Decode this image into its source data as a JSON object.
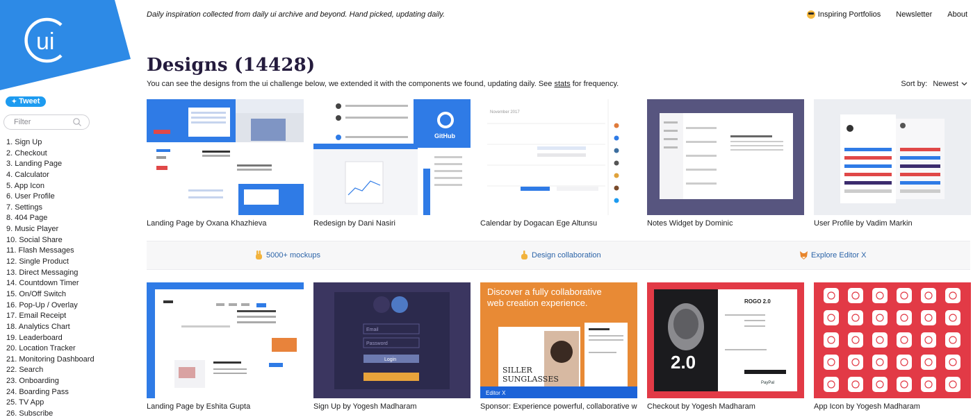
{
  "sidebar": {
    "logo_text": "ui",
    "tweet_label": "Tweet",
    "filter_placeholder": "Filter",
    "categories": [
      "1. Sign Up",
      "2. Checkout",
      "3. Landing Page",
      "4. Calculator",
      "5. App Icon",
      "6. User Profile",
      "7. Settings",
      "8. 404 Page",
      "9. Music Player",
      "10. Social Share",
      "11. Flash Messages",
      "12. Single Product",
      "13. Direct Messaging",
      "14. Countdown Timer",
      "15. On/Off Switch",
      "16. Pop-Up / Overlay",
      "17. Email Receipt",
      "18. Analytics Chart",
      "19. Leaderboard",
      "20. Location Tracker",
      "21. Monitoring Dashboard",
      "22. Search",
      "23. Onboarding",
      "24. Boarding Pass",
      "25. TV App",
      "26. Subscribe"
    ]
  },
  "header": {
    "tagline": "Daily inspiration collected from daily ui archive and beyond. Hand picked, updating daily.",
    "nav": [
      "Inspiring Portfolios",
      "Newsletter",
      "About"
    ]
  },
  "main": {
    "title": "Designs (14428)",
    "subtitle_before": "You can see the designs from the ui challenge below, we extended it with the components we found, updating daily. See ",
    "subtitle_link": "stats",
    "subtitle_after": " for frequency.",
    "sort_label": "Sort by:",
    "sort_value": "Newest"
  },
  "row1": [
    "Landing Page by Oxana Khazhieva",
    "Redesign by Dani Nasiri",
    "Calendar by Dogacan Ege Altunsu",
    "Notes Widget by Dominic",
    "User Profile by Vadim Markin"
  ],
  "promo": [
    "5000+ mockups",
    "Design collaboration",
    "Explore Editor X"
  ],
  "row2": [
    "Landing Page by Eshita Gupta",
    "Sign Up by Yogesh Madharam",
    "Sponsor: Experience powerful, collaborative web",
    "Checkout by Yogesh Madharam",
    "App Icon by Yogesh Madharam"
  ],
  "thumb_text": {
    "github": "GitHub",
    "calendar_month": "November 2017",
    "signup_email": "Email",
    "signup_password": "Password",
    "signup_button": "Login",
    "sponsor_headline_1": "Discover a fully collaborative",
    "sponsor_headline_2": "web creation experience.",
    "sponsor_card_1": "SILLER",
    "sponsor_card_2": "SUNGLASSES",
    "sponsor_footer": "Editor X",
    "checkout_brand": "ROGO 2.0",
    "checkout_number": "2.0",
    "checkout_paypal": "PayPal"
  },
  "colors": {
    "brand_blue": "#2d8ae6",
    "title_purple": "#241b3d",
    "link_blue": "#2c64a8",
    "tweet_blue": "#1d9bf0"
  },
  "icons": {
    "portfolios": "sunglasses-emoji-icon",
    "sort": "chevron-down-icon",
    "filter": "search-icon",
    "promo": [
      "victory-hand-icon",
      "hand-icon",
      "fox-icon"
    ]
  }
}
